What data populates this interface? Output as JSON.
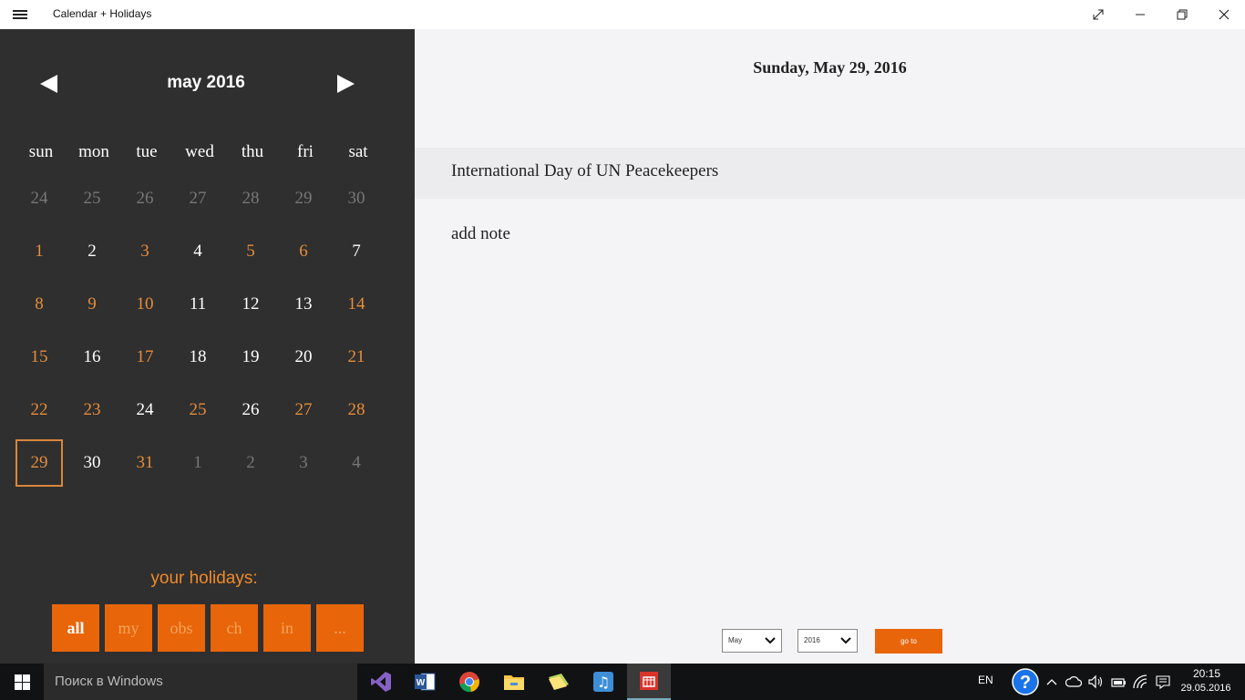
{
  "window": {
    "title": "Calendar + Holidays"
  },
  "calendar": {
    "month_title": "may 2016",
    "weekdays": [
      "sun",
      "mon",
      "tue",
      "wed",
      "thu",
      "fri",
      "sat"
    ],
    "weeks": [
      [
        {
          "d": "24",
          "t": "out"
        },
        {
          "d": "25",
          "t": "out"
        },
        {
          "d": "26",
          "t": "out"
        },
        {
          "d": "27",
          "t": "out"
        },
        {
          "d": "28",
          "t": "out"
        },
        {
          "d": "29",
          "t": "out"
        },
        {
          "d": "30",
          "t": "out"
        }
      ],
      [
        {
          "d": "1",
          "t": "holiday"
        },
        {
          "d": "2",
          "t": "normal"
        },
        {
          "d": "3",
          "t": "holiday"
        },
        {
          "d": "4",
          "t": "normal"
        },
        {
          "d": "5",
          "t": "holiday"
        },
        {
          "d": "6",
          "t": "holiday"
        },
        {
          "d": "7",
          "t": "normal"
        }
      ],
      [
        {
          "d": "8",
          "t": "holiday"
        },
        {
          "d": "9",
          "t": "holiday"
        },
        {
          "d": "10",
          "t": "holiday"
        },
        {
          "d": "11",
          "t": "normal"
        },
        {
          "d": "12",
          "t": "normal"
        },
        {
          "d": "13",
          "t": "normal"
        },
        {
          "d": "14",
          "t": "holiday"
        }
      ],
      [
        {
          "d": "15",
          "t": "holiday"
        },
        {
          "d": "16",
          "t": "normal"
        },
        {
          "d": "17",
          "t": "holiday"
        },
        {
          "d": "18",
          "t": "normal"
        },
        {
          "d": "19",
          "t": "normal"
        },
        {
          "d": "20",
          "t": "normal"
        },
        {
          "d": "21",
          "t": "holiday"
        }
      ],
      [
        {
          "d": "22",
          "t": "holiday"
        },
        {
          "d": "23",
          "t": "holiday"
        },
        {
          "d": "24",
          "t": "normal"
        },
        {
          "d": "25",
          "t": "holiday"
        },
        {
          "d": "26",
          "t": "normal"
        },
        {
          "d": "27",
          "t": "holiday"
        },
        {
          "d": "28",
          "t": "holiday"
        }
      ],
      [
        {
          "d": "29",
          "t": "holiday",
          "selected": true
        },
        {
          "d": "30",
          "t": "normal"
        },
        {
          "d": "31",
          "t": "holiday"
        },
        {
          "d": "1",
          "t": "out"
        },
        {
          "d": "2",
          "t": "out"
        },
        {
          "d": "3",
          "t": "out"
        },
        {
          "d": "4",
          "t": "out"
        }
      ]
    ]
  },
  "holidays": {
    "label": "your holidays:",
    "filters": [
      {
        "label": "all",
        "active": true
      },
      {
        "label": "my",
        "active": false
      },
      {
        "label": "obs",
        "active": false
      },
      {
        "label": "ch",
        "active": false
      },
      {
        "label": "in",
        "active": false
      },
      {
        "label": "...",
        "active": false
      }
    ]
  },
  "detail": {
    "date_heading": "Sunday, May 29, 2016",
    "holiday_name": "International Day of UN Peacekeepers",
    "add_note_label": "add note"
  },
  "goto": {
    "month_value": "May",
    "year_value": "2016",
    "button_label": "go to"
  },
  "taskbar": {
    "search_placeholder": "Поиск в Windows",
    "apps": [
      "visual-studio-icon",
      "word-icon",
      "chrome-icon",
      "file-explorer-icon",
      "folder-icon",
      "music-app-icon",
      "calendar-holidays-icon"
    ],
    "language": "EN",
    "time": "20:15",
    "date": "29.05.2016"
  },
  "colors": {
    "accent": "#e8650a",
    "holiday_text": "#e58d3b",
    "panel_bg": "#2f2f2f",
    "content_bg": "#f4f4f6"
  }
}
